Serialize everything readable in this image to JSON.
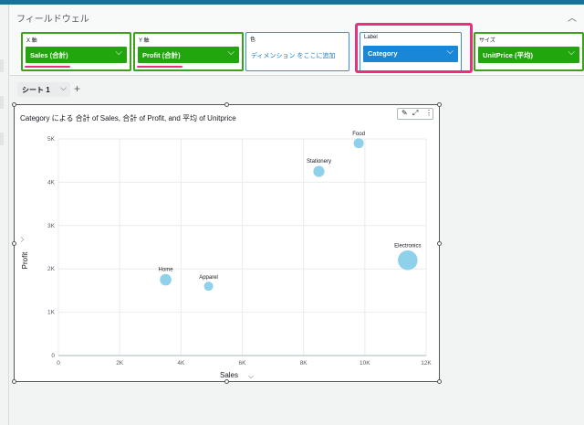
{
  "field_well": {
    "title": "フィールドウェル",
    "wells": {
      "x": {
        "label": "X 軸",
        "field": "Sales (合計)"
      },
      "y": {
        "label": "Y 軸",
        "field": "Profit (合計)"
      },
      "color": {
        "label": "色",
        "hint": "ディメンション をここに追加"
      },
      "label": {
        "label": "Label",
        "field": "Category"
      },
      "size": {
        "label": "サイズ",
        "field": "UnitPrice (平均)"
      }
    }
  },
  "tabs": {
    "sheet": "シート 1",
    "add": "+"
  },
  "visual": {
    "title": "Category による 合計 of Sales, 合計 of Profit, and 平均 of Unitprice"
  },
  "colors": {
    "accent": "#22a60d",
    "highlight": "#e8317a",
    "bubble": "#8fd0ea",
    "label_pill": "#1a86d6"
  },
  "chart_data": {
    "type": "scatter",
    "xlabel": "Sales",
    "ylabel": "Profit",
    "xlim": [
      0,
      12000
    ],
    "ylim": [
      0,
      5000
    ],
    "xticks": [
      "0",
      "2K",
      "4K",
      "6K",
      "8K",
      "10K",
      "12K"
    ],
    "yticks": [
      "0",
      "1K",
      "2K",
      "3K",
      "4K",
      "5K"
    ],
    "points": [
      {
        "label": "Home",
        "x": 3500,
        "y": 1750,
        "size": 0.45
      },
      {
        "label": "Apparel",
        "x": 4900,
        "y": 1600,
        "size": 0.28
      },
      {
        "label": "Stationery",
        "x": 8500,
        "y": 4250,
        "size": 0.42
      },
      {
        "label": "Food",
        "x": 9800,
        "y": 4900,
        "size": 0.35
      },
      {
        "label": "Electronics",
        "x": 11400,
        "y": 2200,
        "size": 1.0
      }
    ]
  }
}
